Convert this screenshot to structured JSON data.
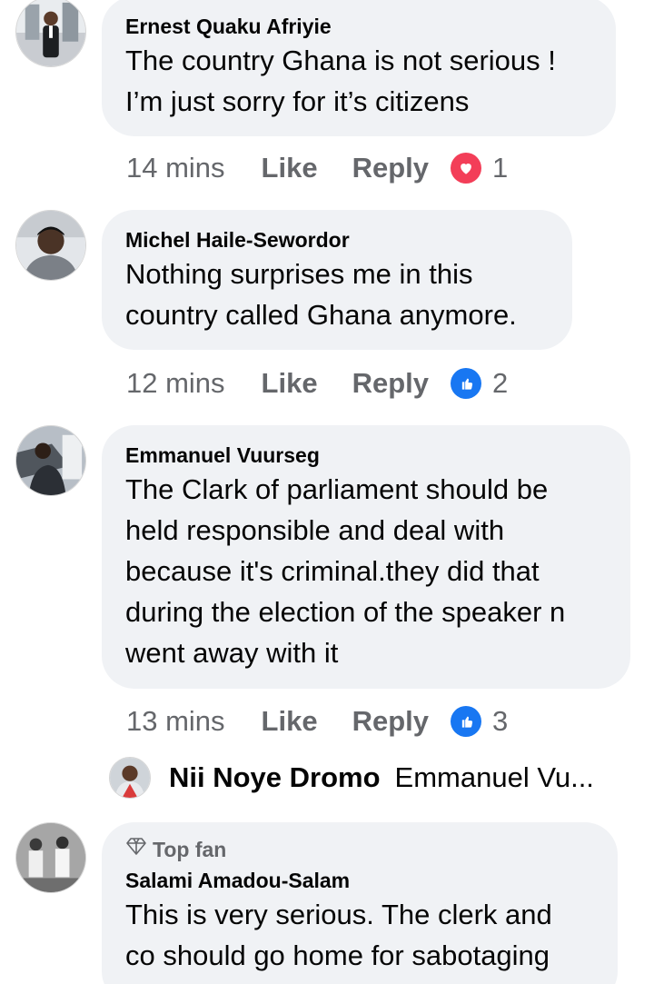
{
  "comments": [
    {
      "author": "Ernest Quaku Afriyie",
      "text": "The country Ghana is not serious !\nI’m just sorry for it’s citizens",
      "time": "14 mins",
      "like_label": "Like",
      "reply_label": "Reply",
      "reaction": {
        "type": "love",
        "icon": "heart-icon",
        "color": "#f33e58",
        "count": "1"
      }
    },
    {
      "author": "Michel Haile-Sewordor",
      "text": "Nothing surprises me in this\ncountry called Ghana anymore.",
      "time": "12 mins",
      "like_label": "Like",
      "reply_label": "Reply",
      "reaction": {
        "type": "like",
        "icon": "thumbs-up-icon",
        "color": "#1877f2",
        "count": "2"
      }
    },
    {
      "author": "Emmanuel Vuurseg",
      "text": "The Clark of parliament should be\nheld responsible and deal with\nbecause it's criminal.they did that\nduring the election of the speaker n\nwent away with it",
      "time": "13 mins",
      "like_label": "Like",
      "reply_label": "Reply",
      "reaction": {
        "type": "like",
        "icon": "thumbs-up-icon",
        "color": "#1877f2",
        "count": "3"
      },
      "reply_preview": {
        "author": "Nii Noye Dromo",
        "text": "Emmanuel Vu..."
      }
    },
    {
      "badge": "Top fan",
      "badge_icon": "diamond-icon",
      "author": "Salami Amadou-Salam",
      "text": "This is very serious. The clerk and\nco should go home for sabotaging"
    }
  ],
  "colors": {
    "bubble": "#f0f2f5",
    "meta": "#65676b",
    "text": "#050505"
  }
}
